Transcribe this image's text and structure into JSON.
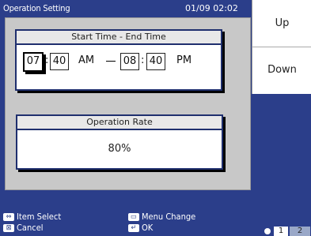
{
  "title": "Operation Setting",
  "datetime": "01/09 02:02",
  "time_group": {
    "header": "Start Time - End Time",
    "start_hour": "07",
    "start_min": "40",
    "start_ampm": "AM",
    "end_hour": "08",
    "end_min": "40",
    "end_ampm": "PM",
    "sep": ":"
  },
  "rate_group": {
    "header": "Operation Rate",
    "value": "80%"
  },
  "side_buttons": {
    "up": "Up",
    "down": "Down"
  },
  "help": {
    "item_select": "Item Select",
    "cancel": "Cancel",
    "menu_change": "Menu Change",
    "ok": "OK"
  },
  "pages": {
    "one": "1",
    "two": "2"
  },
  "icons": {
    "lr": "left-right-arrows-icon",
    "cancel": "cancel-icon",
    "menu": "menu-icon",
    "enter": "enter-icon"
  },
  "colors": {
    "background": "#2b3e8a",
    "panel": "#c8c8c8",
    "border": "#1f2f6e"
  }
}
